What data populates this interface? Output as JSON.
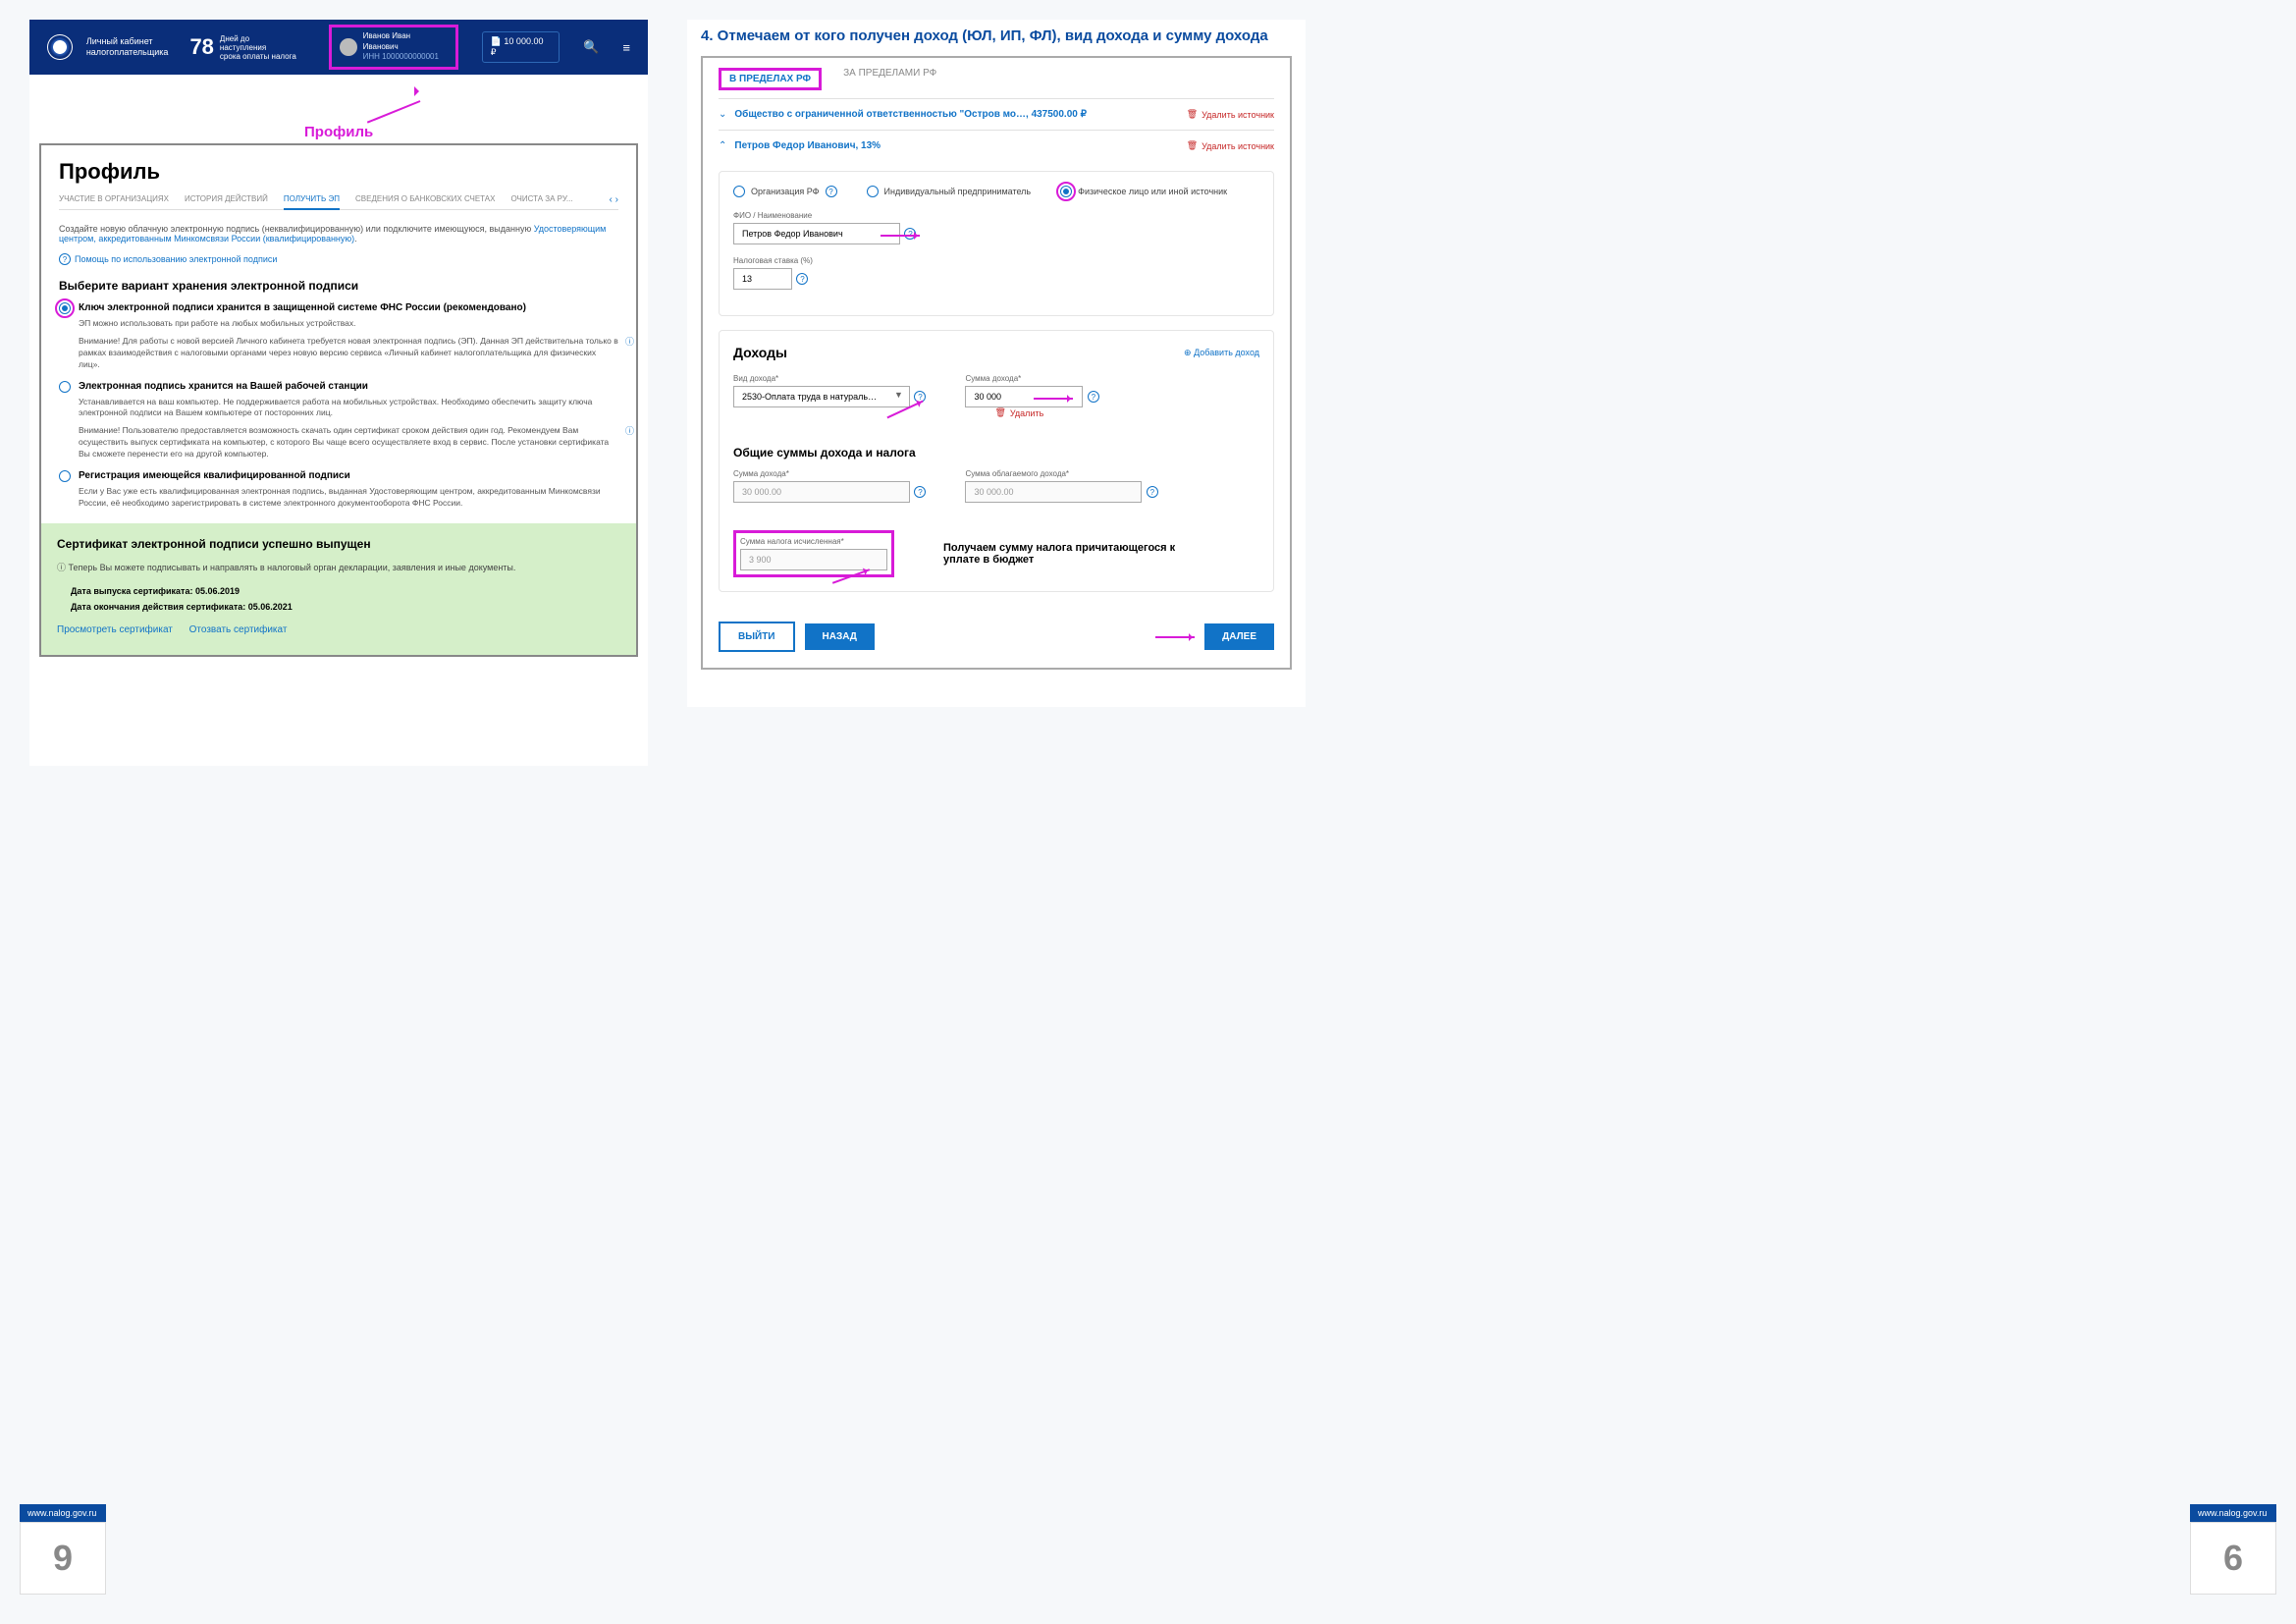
{
  "header": {
    "lk_label": "Личный кабинет\nналогоплательщика",
    "days_num": "78",
    "days_text": "Дней до наступления\nсрока оплаты налога",
    "user_name": "Иванов Иван Иванович",
    "user_inn": "ИНН 1000000000001",
    "balance": "10 000.00 ₽"
  },
  "profile_label": "Профиль",
  "profile_heading": "Профиль",
  "tabs": [
    "УЧАСТИЕ В ОРГАНИЗАЦИЯХ",
    "ИСТОРИЯ ДЕЙСТВИЙ",
    "ПОЛУЧИТЬ ЭП",
    "СВЕДЕНИЯ О БАНКОВСКИХ СЧЕТАХ",
    "ОЧИСТА ЗА РУ..."
  ],
  "tab_active_idx": 2,
  "intro_pre": "Создайте новую облачную электронную подпись (неквалифицированную) или подключите имеющуюся, выданную ",
  "intro_link": "Удостоверяющим центром, аккредитованным Минкомсвязи России (квалифицированную)",
  "help_link": "Помощь по использованию электронной подписи",
  "choose_heading": "Выберите вариант хранения электронной подписи",
  "options": [
    {
      "title": "Ключ электронной подписи хранится в защищенной системе ФНС России (рекомендовано)",
      "sub": "ЭП можно использовать при работе на любых мобильных устройствах.",
      "warn": "Внимание! Для работы с новой версией Личного кабинета требуется новая электронная подпись (ЭП). Данная ЭП действительна только в рамках взаимодействия с налоговыми органами через новую версию сервиса «Личный кабинет налогоплательщика для физических лиц».",
      "selected": true,
      "highlight": true
    },
    {
      "title": "Электронная подпись хранится на Вашей рабочей станции",
      "sub": "Устанавливается на ваш компьютер. Не поддерживается работа на мобильных устройствах. Необходимо обеспечить защиту ключа электронной подписи на Вашем компьютере от посторонних лиц.",
      "warn": "Внимание! Пользователю предоставляется возможность скачать один сертификат сроком действия один год. Рекомендуем Вам осуществить выпуск сертификата на компьютер, с которого Вы чаще всего осуществляете вход в сервис. После установки сертификата Вы сможете перенести его на другой компьютер.",
      "selected": false
    },
    {
      "title": "Регистрация имеющейся квалифицированной подписи",
      "sub": "Если у Вас уже есть квалифицированная электронная подпись, выданная Удостоверяющим центром, аккредитованным Минкомсвязи России, её необходимо зарегистрировать в системе электронного документооборота ФНС России.",
      "selected": false
    }
  ],
  "success": {
    "heading": "Сертификат электронной подписи успешно выпущен",
    "note": "Теперь Вы можете подписывать и направлять в налоговый орган декларации, заявления и иные документы.",
    "date1": "Дата выпуска сертификата: 05.06.2019",
    "date2": "Дата окончания действия сертификата: 05.06.2021",
    "view": "Просмотреть сертификат",
    "revoke": "Отозвать сертификат"
  },
  "step_title": "4. Отмечаем от кого получен доход (ЮЛ, ИП, ФЛ), вид дохода и сумму дохода",
  "ftabs": {
    "in": "В ПРЕДЕЛАХ РФ",
    "out": "ЗА ПРЕДЕЛАМИ РФ"
  },
  "source1": "Общество с ограниченной ответственностью \"Остров мо…, 437500.00 ₽",
  "source2": "Петров Федор Иванович, 13%",
  "delete_label": "Удалить источник",
  "src_radios": [
    "Организация РФ",
    "Индивидуальный предприниматель",
    "Физическое лицо или иной источник"
  ],
  "fio_label": "ФИО / Наименование",
  "fio_value": "Петров Федор Иванович",
  "rate_label": "Налоговая ставка (%)",
  "rate_value": "13",
  "incomes_heading": "Доходы",
  "add_income": "Добавить доход",
  "income_kind_label": "Вид дохода*",
  "income_kind_value": "2530-Оплата труда в натураль…",
  "income_sum_label": "Сумма дохода*",
  "income_sum_value": "30 000",
  "delete_row": "Удалить",
  "totals_heading": "Общие суммы дохода и налога",
  "total_income_label": "Сумма дохода*",
  "total_income_value": "30 000.00",
  "taxable_label": "Сумма облагаемого дохода*",
  "taxable_value": "30 000.00",
  "calc_tax_label": "Сумма налога исчисленная*",
  "calc_tax_value": "3 900",
  "tax_note": "Получаем сумму налога причитающегося к уплате в бюджет",
  "buttons": {
    "exit": "ВЫЙТИ",
    "back": "НАЗАД",
    "next": "ДАЛЕЕ"
  },
  "pink_plus": "⊕",
  "qmark": "?",
  "trash": "🗑",
  "url": "www.nalog.gov.ru",
  "page_left": "9",
  "page_right": "6"
}
